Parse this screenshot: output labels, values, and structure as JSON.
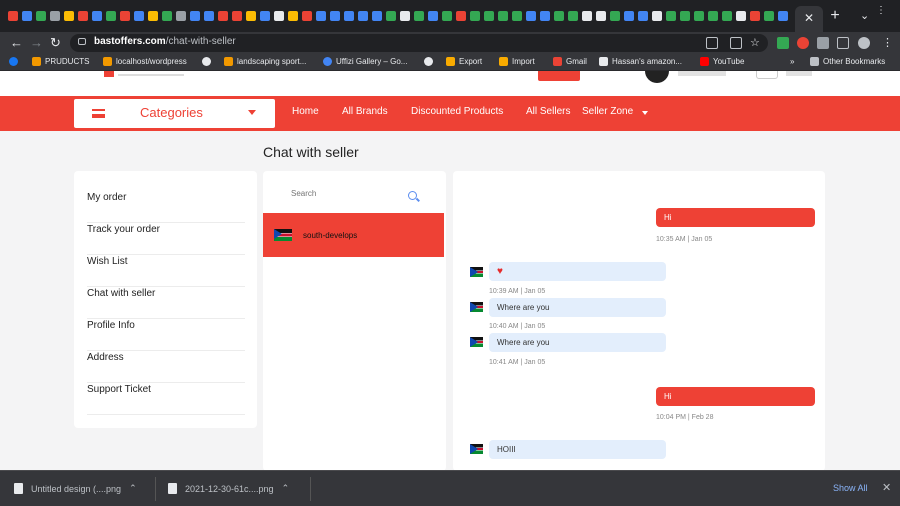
{
  "browser": {
    "close_tab_glyph": "✕",
    "new_tab_glyph": "+",
    "url_domain": "bastoffers.com",
    "url_path": "/chat-with-seller",
    "bookmarks": [
      "PRUDUCTS",
      "localhost/wordpress",
      "landscaping sport...",
      "Uffizi Gallery – Go...",
      "Export",
      "Import",
      "Gmail",
      "Hassan's amazon...",
      "YouTube",
      "Other Bookmarks"
    ],
    "overflow_glyph": "»"
  },
  "site": {
    "nav": {
      "categories_label": "Categories",
      "links": [
        "Home",
        "All Brands",
        "Discounted Products",
        "All Sellers",
        "Seller Zone"
      ]
    },
    "page_title": "Chat with seller",
    "sidebar": [
      "My order",
      "Track your order",
      "Wish List",
      "Chat with seller",
      "Profile Info",
      "Address",
      "Support Ticket"
    ],
    "search_placeholder": "Search",
    "conversation": {
      "name": "south-develops"
    },
    "messages": [
      {
        "dir": "out",
        "text": "Hi",
        "time": "10:35 AM | Jan 05"
      },
      {
        "dir": "in",
        "text": "♥",
        "time": "10:39 AM | Jan 05"
      },
      {
        "dir": "in",
        "text": "Where are you",
        "time": "10:40 AM | Jan 05"
      },
      {
        "dir": "in",
        "text": "Where are you",
        "time": "10:41 AM | Jan 05"
      },
      {
        "dir": "out",
        "text": "Hi",
        "time": "10:04 PM | Feb 28"
      },
      {
        "dir": "in",
        "text": "HOIII",
        "time": ""
      }
    ]
  },
  "downloads": {
    "items": [
      "Untitled design (....png",
      "2021-12-30-61c....png"
    ],
    "show_all": "Show All",
    "close_glyph": "✕"
  },
  "colors": {
    "accent": "#ee4135",
    "incoming_bubble": "#e3eefc"
  }
}
